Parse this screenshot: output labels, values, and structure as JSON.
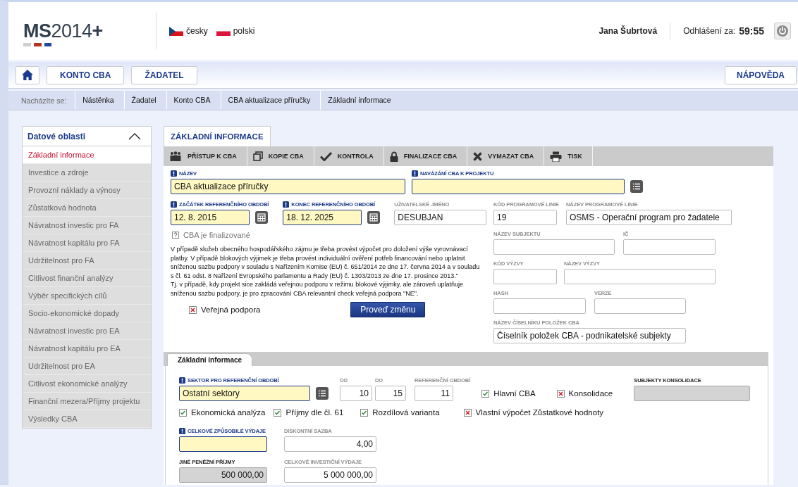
{
  "header": {
    "logo": "**MS**2014**+**",
    "languages": [
      {
        "label": "česky",
        "kind": "cz"
      },
      {
        "label": "polski",
        "kind": "pl"
      }
    ],
    "user": "Jana Šubrtová",
    "logout_label": "Odhlášení za:",
    "countdown": "59:55"
  },
  "nav": {
    "buttons": [
      {
        "kind": "home"
      },
      {
        "kind": "text",
        "label": "KONTO CBA"
      },
      {
        "kind": "text",
        "label": "ŽADATEL"
      }
    ],
    "help": "NÁPOVĚDA"
  },
  "breadcrumb": {
    "prefix": "Nacházíte se:",
    "items": [
      "Nástěnka",
      "Žadatel",
      "Konto CBA",
      "CBA aktualizace příručky",
      "Základní informace"
    ]
  },
  "sidebar": {
    "title": "Datové oblasti",
    "expanded": true,
    "items": [
      {
        "label": "Základní informace",
        "selected": true
      },
      {
        "label": "Investice a zdroje",
        "selected": false
      },
      {
        "label": "Provozní náklady a výnosy",
        "selected": false
      },
      {
        "label": "Zůstatková hodnota",
        "selected": false
      },
      {
        "label": "Návratnost investic pro FA",
        "selected": false
      },
      {
        "label": "Návratnost kapitálu pro FA",
        "selected": false
      },
      {
        "label": "Udržitelnost pro FA",
        "selected": false
      },
      {
        "label": "Citlivost finanční analýzy",
        "selected": false
      },
      {
        "label": "Výběr specifických cílů",
        "selected": false
      },
      {
        "label": "Socio-ekonomické dopady",
        "selected": false
      },
      {
        "label": "Návratnost investic pro EA",
        "selected": false
      },
      {
        "label": "Návratnost kapitálu pro EA",
        "selected": false
      },
      {
        "label": "Udržitelnost pro EA",
        "selected": false
      },
      {
        "label": "Citlivost ekonomické analýzy",
        "selected": false
      },
      {
        "label": "Finanční mezera/Příjmy projektu",
        "selected": false
      },
      {
        "label": "Výsledky CBA",
        "selected": false
      }
    ]
  },
  "tabs": [
    {
      "label": "ZÁKLADNÍ INFORMACE",
      "selected": true
    }
  ],
  "toolbar": [
    {
      "kind": "people",
      "label": "PŘÍSTUP K CBA"
    },
    {
      "kind": "copy",
      "label": "KOPIE CBA"
    },
    {
      "kind": "check",
      "label": "KONTROLA"
    },
    {
      "kind": "lock",
      "label": "FINALIZACE CBA"
    },
    {
      "kind": "cross",
      "label": "VYMAZAT CBA"
    },
    {
      "kind": "print",
      "label": "TISK"
    }
  ],
  "form": {
    "name": {
      "label": "NÁZEV",
      "value": "CBA aktualizace příručky",
      "required": true
    },
    "project_link": {
      "label": "NAVÁZÁNÍ CBA K PROJEKTU",
      "required": true,
      "kind": "lookup"
    },
    "period_start": {
      "label": "ZAČÁTEK REFERENČNÍHO OBDOBÍ",
      "value": "12. 8. 2015",
      "required": true,
      "kind": "date"
    },
    "period_end": {
      "label": "KONEC REFERENČNÍHO OBDOBÍ",
      "value": "18. 12. 2025",
      "required": true,
      "kind": "date"
    },
    "username": {
      "label": "UŽIVATELSKÉ JMÉNO",
      "value": "DESUBJAN",
      "required": false
    },
    "finalized_hint": "CBA je finalizované",
    "note": [
      "V případě služeb obecného hospodářského zájmu je třeba provést výpočet pro doložení výše vyrovnávací platby. V případě blokových výjimek je třeba provést individuální ověření potřeb financování nebo uplatnit sníženou sazbu podpory v souladu s Nařízením Komise (EU) č. 651/2014 ze dne 17. června 2014 a v souladu s čl. 61 odst. 8 Nařízení Evropského parlamentu a Rady (EU) č. 1303/2013 ze dne 17. prosince 2013.\"",
      "Tj. v případě, kdy projekt sice zakládá veřejnou podporu v režimu blokové výjimky, ale zároveň uplatňuje sníženou sazbu podpory, je pro zpracování CBA relevantní check veřejná podpora \"NE\"."
    ],
    "public_support": {
      "label": "Veřejná podpora",
      "checked": false
    },
    "apply_button": "Proveď změnu",
    "line_code": {
      "label": "KÓD PROGRAMOVÉ LINIE",
      "value": "19",
      "required": false
    },
    "line_name": {
      "label": "NÁZEV PROGRAMOVÉ LINIE",
      "value": "OSMS - Operační program pro žadatele",
      "required": false
    },
    "subject_name": {
      "label": "NÁZEV SUBJEKTU",
      "required": false
    },
    "ic": {
      "label": "IČ",
      "required": false
    },
    "call_code": {
      "label": "KÓD VÝZVY",
      "required": false
    },
    "call_name": {
      "label": "NÁZEV VÝZVY",
      "required": false
    },
    "hash": {
      "label": "HASH",
      "required": false
    },
    "version": {
      "label": "VERZE",
      "required": false
    },
    "item_list": {
      "label": "NÁZEV ČÍSELNÍKU POLOŽEK CBA",
      "value": "Číselník položek CBA - podnikatelské subjekty",
      "required": false
    }
  },
  "subtabs": [
    {
      "label": "Základní informace",
      "selected": true
    }
  ],
  "details": {
    "sector": {
      "label": "SEKTOR PRO REFERENČNÍ OBDOBÍ",
      "value": "Ostatní sektory",
      "required": true,
      "kind": "lookup"
    },
    "from": {
      "label": "OD",
      "value": "10",
      "required": false,
      "kind": "number"
    },
    "to": {
      "label": "DO",
      "value": "15",
      "required": false,
      "kind": "number"
    },
    "ref_period": {
      "label": "REFERENČNÍ OBDOBÍ",
      "value": "11",
      "required": false,
      "kind": "number"
    },
    "main_cba": {
      "label": "Hlavní CBA",
      "checked": true
    },
    "consolidation": {
      "label": "Konsolidace",
      "checked": false
    },
    "consolidated_subjects": {
      "label": "SUBJEKTY KONSOLIDACE",
      "required": false,
      "disabled": true
    },
    "options": [
      {
        "label": "Ekonomická analýza",
        "checked": true
      },
      {
        "label": "Příjmy dle čl. 61",
        "checked": true
      },
      {
        "label": "Rozdílová varianta",
        "checked": true
      },
      {
        "label": "Vlastní výpočet Zůstatkové hodnoty",
        "checked": false
      }
    ],
    "eligible_costs": {
      "label": "CELKOVÉ ZPŮSOBILÉ VÝDAJE",
      "required": true
    },
    "discount_rate": {
      "label": "DISKONTNÍ SAZBA",
      "value": "4,00",
      "required": false,
      "kind": "number"
    },
    "other_income": {
      "label": "JINÉ PENĚŽNÍ PŘÍJMY",
      "value": "500 000,00",
      "required": false,
      "disabled": true,
      "kind": "number"
    },
    "investment_costs": {
      "label": "CELKOVÉ INVESTIČNÍ VÝDAJE",
      "value": "5 000 000,00",
      "required": false,
      "kind": "number"
    }
  }
}
